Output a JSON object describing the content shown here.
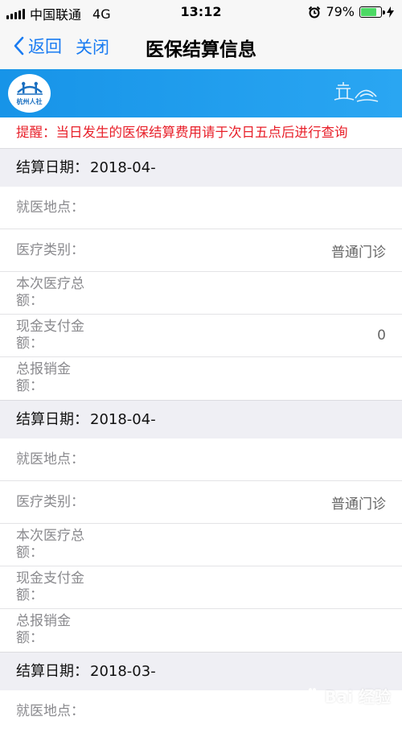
{
  "status_bar": {
    "carrier": "中国联通",
    "network": "4G",
    "time": "13:12",
    "battery_percent": "79%",
    "battery_level": 0.79
  },
  "nav": {
    "back_label": "返回",
    "close_label": "关闭",
    "title": "医保结算信息"
  },
  "banner": {
    "logo_text": "杭州人社"
  },
  "notice": "提醒：当日发生的医保结算费用请于次日五点后进行查询",
  "records": [
    {
      "date_label": "结算日期：",
      "date": "2018-04-",
      "rows": [
        {
          "label": "就医地点：",
          "value": ""
        },
        {
          "label": "医疗类别：",
          "value": "普通门诊"
        },
        {
          "label": "本次医疗总额：",
          "value": ""
        },
        {
          "label": "现金支付金额：",
          "value": "0"
        },
        {
          "label": "总报销金额：",
          "value": ""
        }
      ]
    },
    {
      "date_label": "结算日期：",
      "date": "2018-04-",
      "rows": [
        {
          "label": "就医地点：",
          "value": ""
        },
        {
          "label": "医疗类别：",
          "value": "普通门诊"
        },
        {
          "label": "本次医疗总额：",
          "value": ""
        },
        {
          "label": "现金支付金额：",
          "value": ""
        },
        {
          "label": "总报销金额：",
          "value": ""
        }
      ]
    },
    {
      "date_label": "结算日期：",
      "date": "2018-03-",
      "rows": [
        {
          "label": "就医地点：",
          "value": ""
        }
      ]
    }
  ],
  "watermark": "Bai 经验",
  "colors": {
    "accent": "#1a7cf2",
    "banner": "#1794e8",
    "notice": "#e8202a",
    "battery": "#4cd964"
  }
}
